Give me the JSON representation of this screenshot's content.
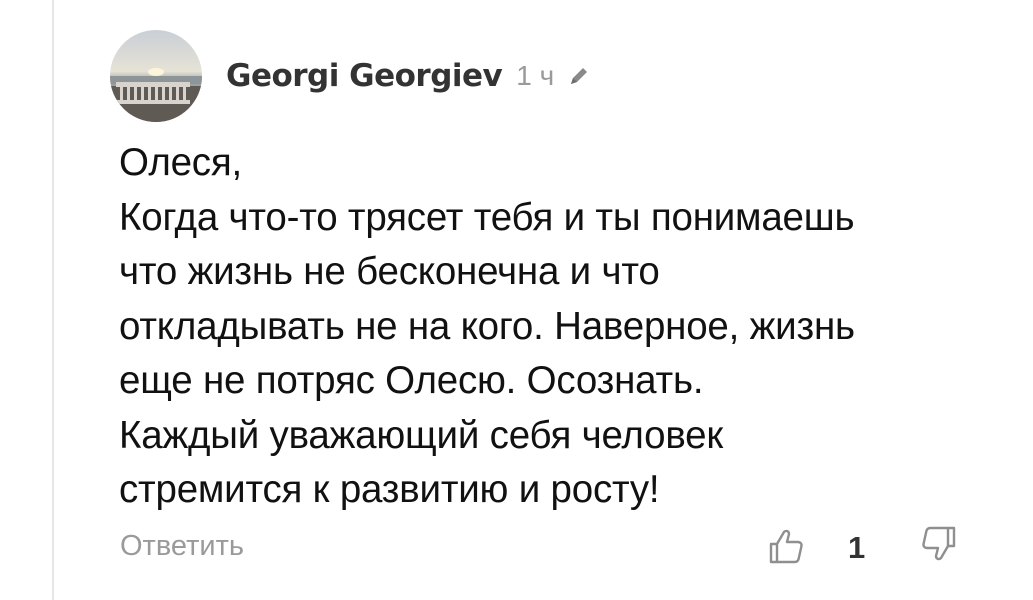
{
  "comment": {
    "author": "Georgi Georgiev",
    "time": "1 ч",
    "text": "Олеся,\nКогда что-то трясет тебя и ты понимаешь\nчто жизнь не бесконечна и что\nоткладывать не на кого. Наверное, жизнь\nеще не потряс Олесю. Осознать.\nКаждый уважающий себя человек\nстремится к развитию и росту!",
    "reply_label": "Ответить",
    "like_count": "1"
  },
  "icons": {
    "edited": "pencil-icon",
    "like": "thumbs-up-icon",
    "dislike": "thumbs-down-icon"
  },
  "colors": {
    "author": "#333333",
    "muted": "#9a9a9a",
    "text": "#111111"
  }
}
